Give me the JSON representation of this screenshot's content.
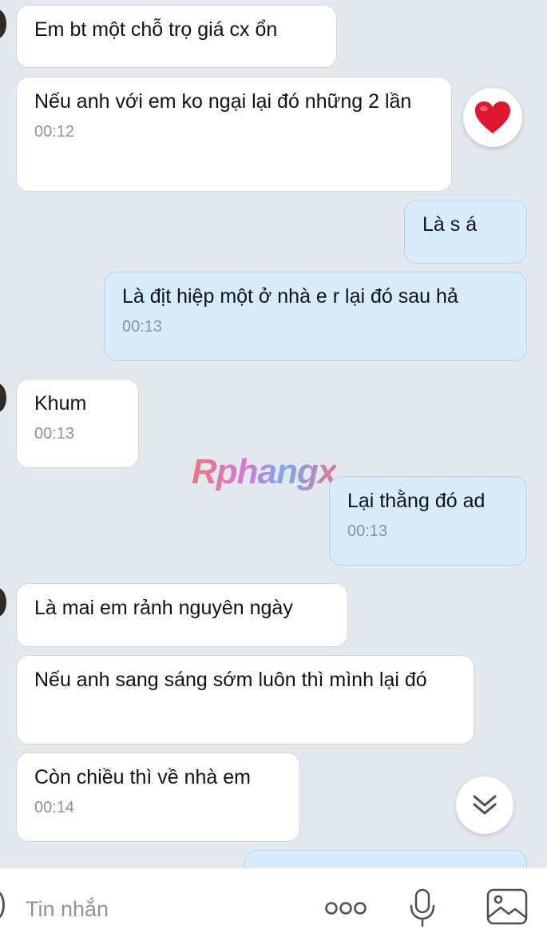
{
  "messages": [
    {
      "side": "in",
      "text": "Em bt một chỗ trọ giá cx ổn",
      "time": ""
    },
    {
      "side": "in",
      "text": "Nếu anh với em ko ngại lại đó những 2 lần",
      "time": "00:12"
    },
    {
      "side": "out",
      "text": "Là s á",
      "time": ""
    },
    {
      "side": "out",
      "text": "Là địt hiệp một ở nhà e r lại đó sau hả",
      "time": "00:13"
    },
    {
      "side": "in",
      "text": "Khum",
      "time": "00:13"
    },
    {
      "side": "out",
      "text": "Lại thằng đó ad",
      "time": "00:13"
    },
    {
      "side": "in",
      "text": "Là mai em rảnh nguyên ngày",
      "time": ""
    },
    {
      "side": "in",
      "text": "Nếu anh sang sáng sớm luôn thì mình lại đó",
      "time": ""
    },
    {
      "side": "in",
      "text": "Còn chiều thì về nhà em",
      "time": "00:14"
    }
  ],
  "reaction": {
    "icon": "heart-icon",
    "color": "#e0182d"
  },
  "watermark": "Rphangx",
  "composer": {
    "placeholder": "Tin nhắn",
    "icons": [
      "emoji-icon",
      "more-icon",
      "microphone-icon",
      "image-icon"
    ]
  },
  "colors": {
    "background": "#e3e7ee",
    "incoming": "#ffffff",
    "outgoing": "#d6ebfb"
  }
}
